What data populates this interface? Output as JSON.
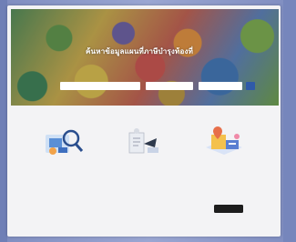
{
  "hero": {
    "title": "ค้นหาข้อมูลแผนที่ภาษีบำรุงท้องที่"
  },
  "search": {
    "field1_placeholder": "",
    "field2_placeholder": "",
    "field3_placeholder": ""
  },
  "features": [
    {
      "icon": "search-map-icon"
    },
    {
      "icon": "parcel-drawing-icon"
    },
    {
      "icon": "location-document-icon"
    }
  ],
  "footer": {
    "center_label": "",
    "store_badge": "",
    "footer_text": ""
  },
  "colors": {
    "accent": "#2f5aa8",
    "background": "#f3f3f5",
    "bezel": "#7f8dc0"
  }
}
